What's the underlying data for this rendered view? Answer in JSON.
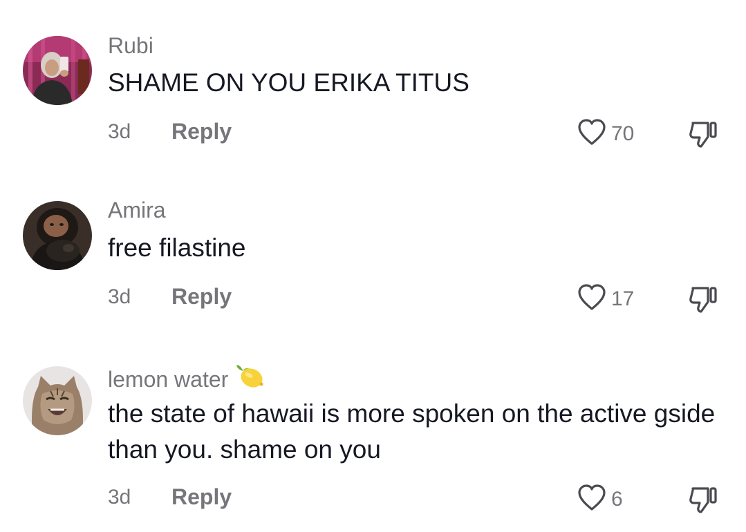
{
  "comments": [
    {
      "username": "Rubi",
      "text": "SHAME ON YOU ERIKA TITUS",
      "time": "3d",
      "reply_label": "Reply",
      "likes": "70"
    },
    {
      "username": "Amira",
      "text": "free filastine",
      "time": "3d",
      "reply_label": "Reply",
      "likes": "17"
    },
    {
      "username": "lemon water",
      "username_emoji": "lemon-icon",
      "text": "the state of hawaii is more spoken on the active gside than you. shame on you",
      "time": "3d",
      "reply_label": "Reply",
      "likes": "6"
    }
  ],
  "icons": {
    "like": "heart-outline-icon",
    "dislike": "thumbs-down-icon"
  },
  "colors": {
    "text": "#161823",
    "secondary": "#75757a",
    "icon": "#4a4a50"
  }
}
